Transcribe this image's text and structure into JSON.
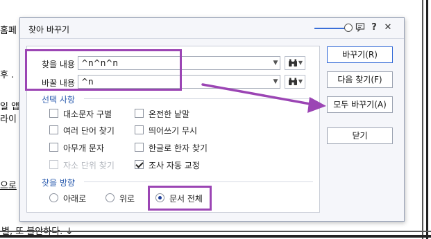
{
  "background_document": {
    "lines": [
      "홈페",
      "후 .",
      "일 앱",
      "라이",
      "으로",
      "별, 또 불안하다. ↓"
    ]
  },
  "dialog": {
    "title": "찾아 바꾸기",
    "titlebar_icons": [
      "comment-icon",
      "help-icon",
      "close-icon"
    ],
    "help_glyph": "?",
    "close_glyph": "✕",
    "find_label": "찾을 내용",
    "find_value": "^n^n^n",
    "replace_label": "바꿀 내용",
    "replace_value": "^n",
    "options_title": "선택 사항",
    "options": [
      {
        "label": "대소문자 구별",
        "checked": false,
        "disabled": false
      },
      {
        "label": "온전한 낱말",
        "checked": false,
        "disabled": false
      },
      {
        "label": "여러 단어 찾기",
        "checked": false,
        "disabled": false
      },
      {
        "label": "띄어쓰기 무시",
        "checked": false,
        "disabled": false
      },
      {
        "label": "아무개 문자",
        "checked": false,
        "disabled": false
      },
      {
        "label": "한글로 한자 찾기",
        "checked": false,
        "disabled": false
      },
      {
        "label": "자소 단위 찾기",
        "checked": false,
        "disabled": true
      },
      {
        "label": "조사 자동 교정",
        "checked": true,
        "disabled": false
      }
    ],
    "direction_title": "찾을 방향",
    "directions": [
      {
        "label": "아래로",
        "selected": false
      },
      {
        "label": "위로",
        "selected": false
      },
      {
        "label": "문서 전체",
        "selected": true
      }
    ],
    "buttons": {
      "replace": "바꾸기(R)",
      "find_next": "다음 찾기(F)",
      "replace_all": "모두 바꾸기(A)",
      "close": "닫기"
    }
  },
  "colors": {
    "annotation": "#9b45b4",
    "accent": "#3a6fd8",
    "section_title": "#2f5fb0"
  }
}
